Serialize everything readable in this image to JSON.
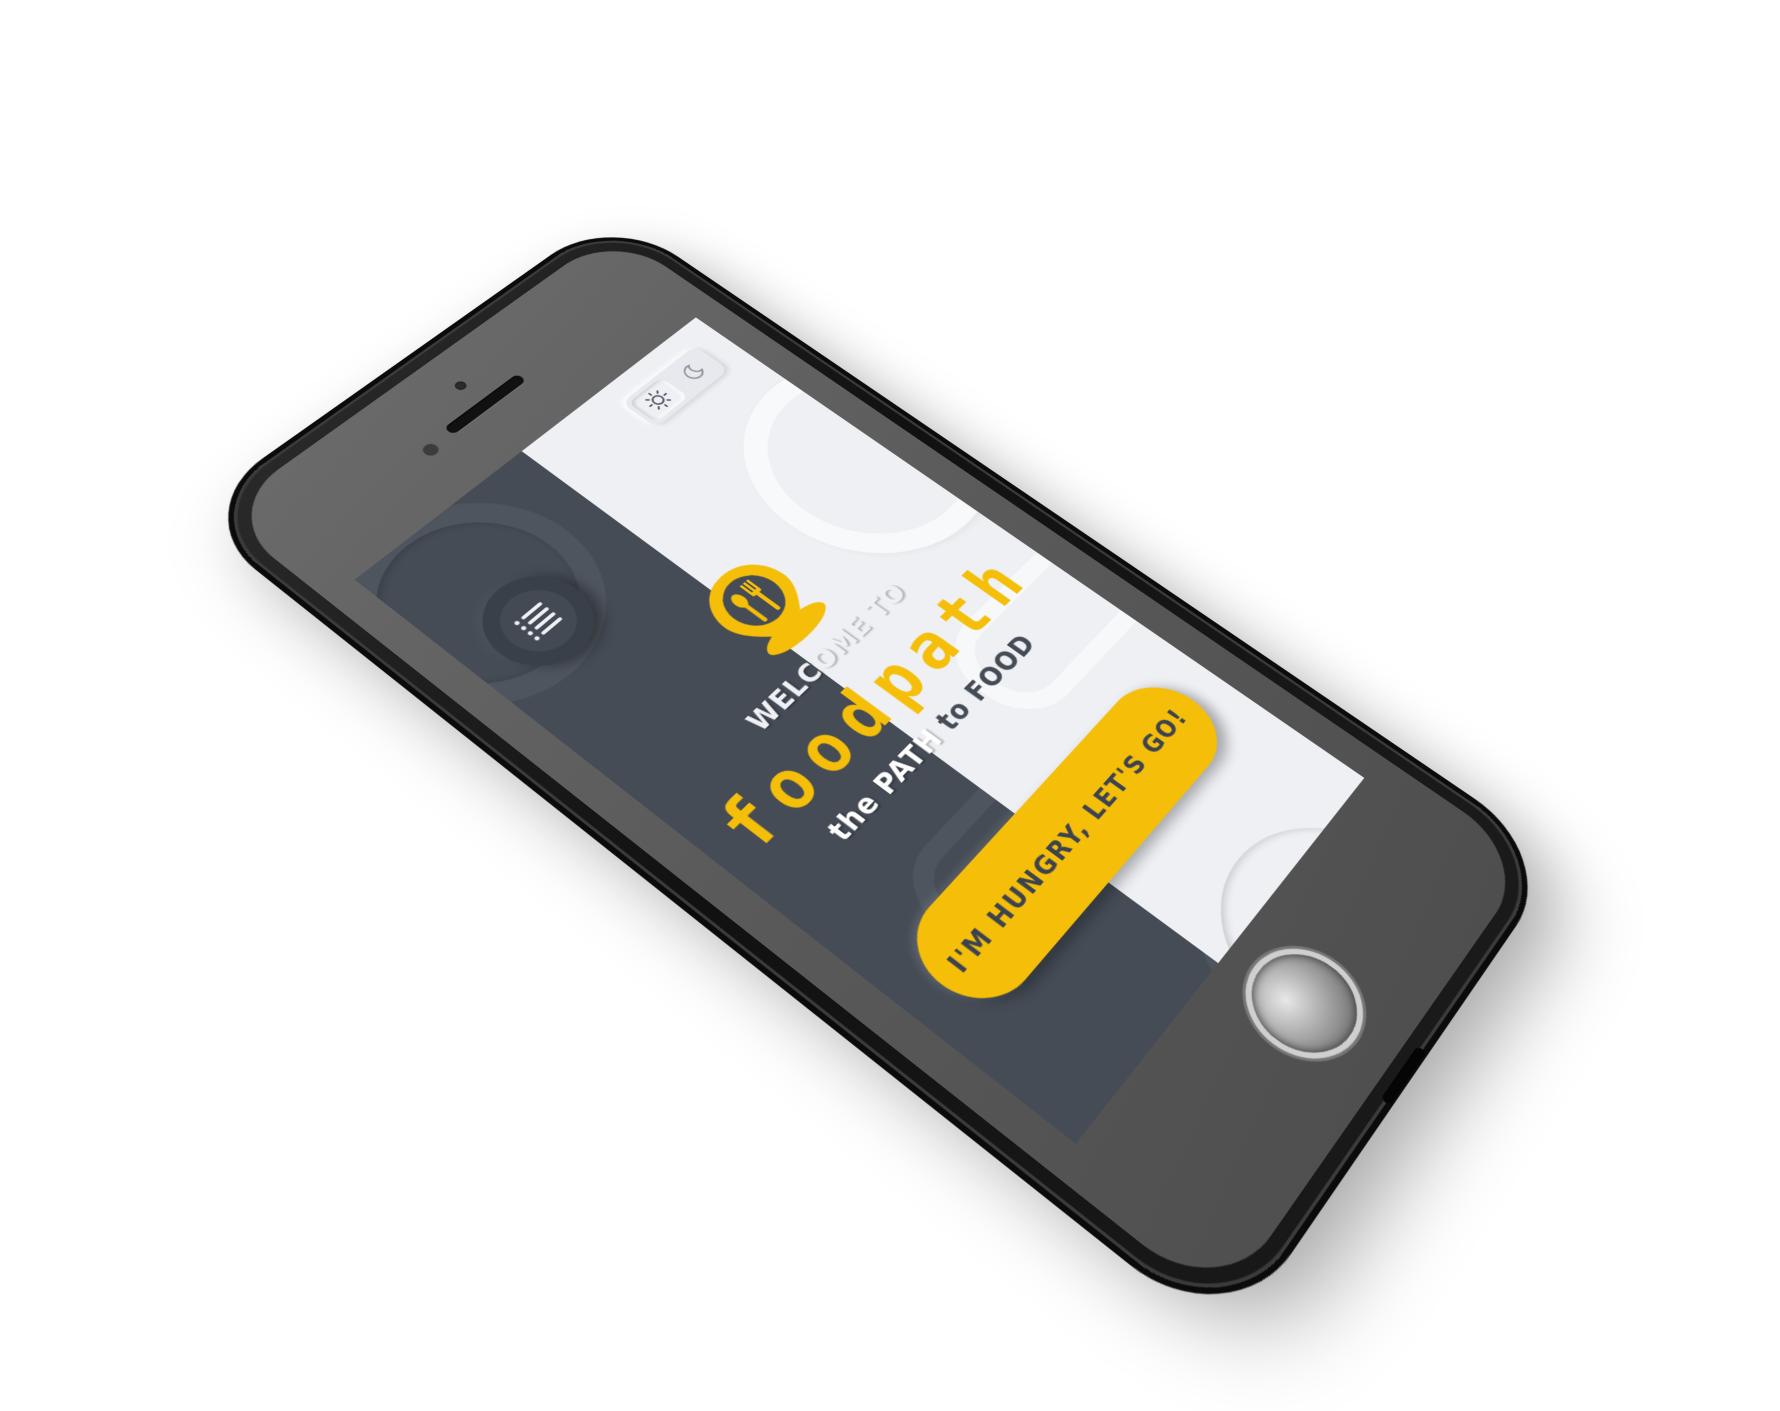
{
  "app": {
    "welcome_text": "WELCOME TO",
    "brand_part1": "food",
    "brand_part2": "path",
    "tagline_part1": "the PATH",
    "tagline_part2": "to FOOD",
    "cta_label": "I'M HUNGRY, LET'S GO!"
  },
  "theme_toggle": {
    "options": [
      {
        "name": "light",
        "icon": "sun-icon",
        "selected": true
      },
      {
        "name": "dark",
        "icon": "moon-icon",
        "selected": false
      }
    ]
  },
  "colors": {
    "dark_bg": "#454c56",
    "light_bg": "#eef0f4",
    "accent": "#f5be08",
    "phone_body": "#111111"
  },
  "icons": {
    "menu": "menu-lines-icon",
    "logo": "location-pin-fork-spoon-logo"
  }
}
